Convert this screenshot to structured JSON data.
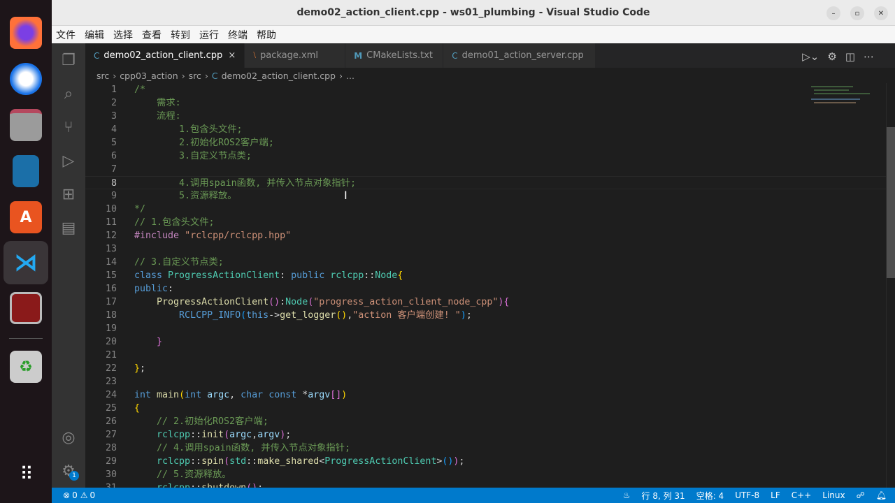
{
  "window": {
    "title": "demo02_action_client.cpp - ws01_plumbing - Visual Studio Code",
    "min": "–",
    "max": "▫",
    "close": "✕"
  },
  "menu": [
    "文件",
    "编辑",
    "选择",
    "查看",
    "转到",
    "运行",
    "终端",
    "帮助"
  ],
  "tabs": [
    {
      "label": "demo02_action_client.cpp",
      "icon": "C",
      "close": "×"
    },
    {
      "label": "package.xml",
      "icon": "⧵"
    },
    {
      "label": "CMakeLists.txt",
      "icon": "M"
    },
    {
      "label": "demo01_action_server.cpp",
      "icon": "C"
    }
  ],
  "breadcrumb": [
    "src",
    "cpp03_action",
    "src",
    "demo02_action_client.cpp",
    "..."
  ],
  "breadcrumb_sep": "›",
  "code": {
    "current_line": 8,
    "lines": [
      [
        [
          "/*",
          "c"
        ]
      ],
      [
        [
          "    需求:",
          "c"
        ]
      ],
      [
        [
          "    流程:",
          "c"
        ]
      ],
      [
        [
          "        1.包含头文件;",
          "c"
        ]
      ],
      [
        [
          "        2.初始化ROS2客户端;",
          "c"
        ]
      ],
      [
        [
          "        3.自定义节点类;",
          "c"
        ]
      ],
      [],
      [
        [
          "        4.调用spain函数, 并传入节点对象指针;",
          "c"
        ]
      ],
      [
        [
          "        5.资源释放。",
          "c"
        ]
      ],
      [
        [
          "*/",
          "c"
        ]
      ],
      [
        [
          "// 1.包含头文件;",
          "c"
        ]
      ],
      [
        [
          "#include ",
          "pp"
        ],
        [
          "\"rclcpp/rclcpp.hpp\"",
          "s"
        ]
      ],
      [],
      [
        [
          "// 3.自定义节点类;",
          "c"
        ]
      ],
      [
        [
          "class ",
          "k"
        ],
        [
          "ProgressActionClient",
          "t"
        ],
        [
          ": ",
          "p"
        ],
        [
          "public ",
          "k"
        ],
        [
          "rclcpp",
          "t"
        ],
        [
          "::",
          "p"
        ],
        [
          "Node",
          "t"
        ],
        [
          "{",
          "b1"
        ]
      ],
      [
        [
          "public",
          "k"
        ],
        [
          ":",
          "p"
        ]
      ],
      [
        [
          "    ",
          "p"
        ],
        [
          "ProgressActionClient",
          "f"
        ],
        [
          "()",
          "b2"
        ],
        [
          ":",
          "p"
        ],
        [
          "Node",
          "t"
        ],
        [
          "(",
          "b2"
        ],
        [
          "\"progress_action_client_node_cpp\"",
          "s"
        ],
        [
          ")",
          "b2"
        ],
        [
          "{",
          "b2"
        ]
      ],
      [
        [
          "        ",
          "p"
        ],
        [
          "RCLCPP_INFO",
          "m"
        ],
        [
          "(",
          "b3"
        ],
        [
          "this",
          "k"
        ],
        [
          "->",
          "p"
        ],
        [
          "get_logger",
          "f"
        ],
        [
          "()",
          "b1"
        ],
        [
          ",",
          "p"
        ],
        [
          "\"action 客户端创建! \"",
          "s"
        ],
        [
          ")",
          "b3"
        ],
        [
          ";",
          "p"
        ]
      ],
      [],
      [
        [
          "    ",
          "p"
        ],
        [
          "}",
          "b2"
        ]
      ],
      [],
      [
        [
          "}",
          "b1"
        ],
        [
          ";",
          "p"
        ]
      ],
      [],
      [
        [
          "int ",
          "k"
        ],
        [
          "main",
          "f"
        ],
        [
          "(",
          "b1"
        ],
        [
          "int ",
          "k"
        ],
        [
          "argc",
          "v"
        ],
        [
          ", ",
          "p"
        ],
        [
          "char ",
          "k"
        ],
        [
          "const ",
          "k"
        ],
        [
          "*",
          "p"
        ],
        [
          "argv",
          "v"
        ],
        [
          "[]",
          "b2"
        ],
        [
          ")",
          "b1"
        ]
      ],
      [
        [
          "{",
          "b1"
        ]
      ],
      [
        [
          "    // 2.初始化ROS2客户端;",
          "c"
        ]
      ],
      [
        [
          "    ",
          "p"
        ],
        [
          "rclcpp",
          "t"
        ],
        [
          "::",
          "p"
        ],
        [
          "init",
          "f"
        ],
        [
          "(",
          "b2"
        ],
        [
          "argc",
          "v"
        ],
        [
          ",",
          "p"
        ],
        [
          "argv",
          "v"
        ],
        [
          ")",
          "b2"
        ],
        [
          ";",
          "p"
        ]
      ],
      [
        [
          "    // 4.调用spain函数, 并传入节点对象指针;",
          "c"
        ]
      ],
      [
        [
          "    ",
          "p"
        ],
        [
          "rclcpp",
          "t"
        ],
        [
          "::",
          "p"
        ],
        [
          "spin",
          "f"
        ],
        [
          "(",
          "b2"
        ],
        [
          "std",
          "t"
        ],
        [
          "::",
          "p"
        ],
        [
          "make_shared",
          "f"
        ],
        [
          "<",
          "p"
        ],
        [
          "ProgressActionClient",
          "t"
        ],
        [
          ">",
          "p"
        ],
        [
          "()",
          "b3"
        ],
        [
          ")",
          "b2"
        ],
        [
          ";",
          "p"
        ]
      ],
      [
        [
          "    // 5.资源释放。",
          "c"
        ]
      ],
      [
        [
          "    ",
          "p"
        ],
        [
          "rclcpp",
          "t"
        ],
        [
          "::",
          "p"
        ],
        [
          "shutdown",
          "f"
        ],
        [
          "()",
          "b2"
        ],
        [
          ";",
          "p"
        ]
      ]
    ]
  },
  "status": {
    "errors": "0",
    "warnings": "0",
    "position": "行 8, 列 31",
    "indent": "空格: 4",
    "encoding": "UTF-8",
    "eol": "LF",
    "language": "C++",
    "platform": "Linux"
  },
  "activity_badge": "1",
  "colors": {
    "status": "#007acc",
    "editor": "#1e1e1e"
  }
}
